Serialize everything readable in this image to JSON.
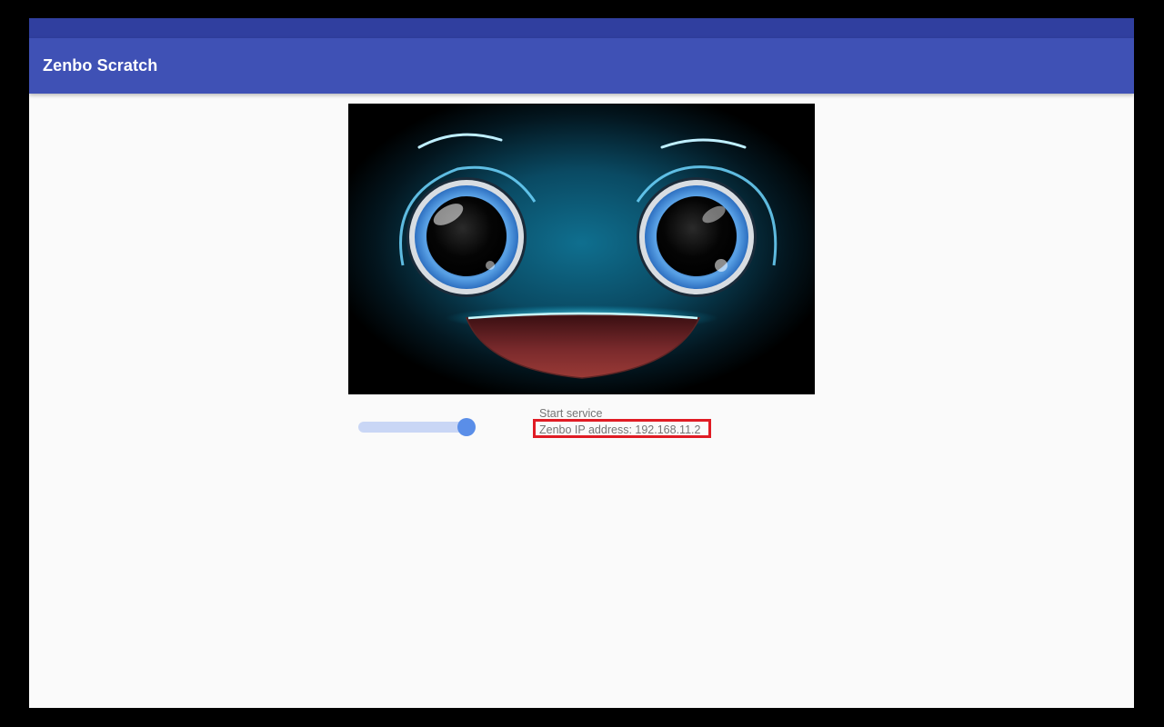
{
  "app_bar": {
    "title": "Zenbo Scratch",
    "color": "#3f51b5",
    "status_bar_color": "#303f9f"
  },
  "face_display": {
    "icon": "robot-face-image"
  },
  "service": {
    "toggle_state": "on",
    "start_label": "Start service",
    "ip_label": "Zenbo IP address: 192.168.11.2",
    "highlight_color": "#e01b24"
  }
}
